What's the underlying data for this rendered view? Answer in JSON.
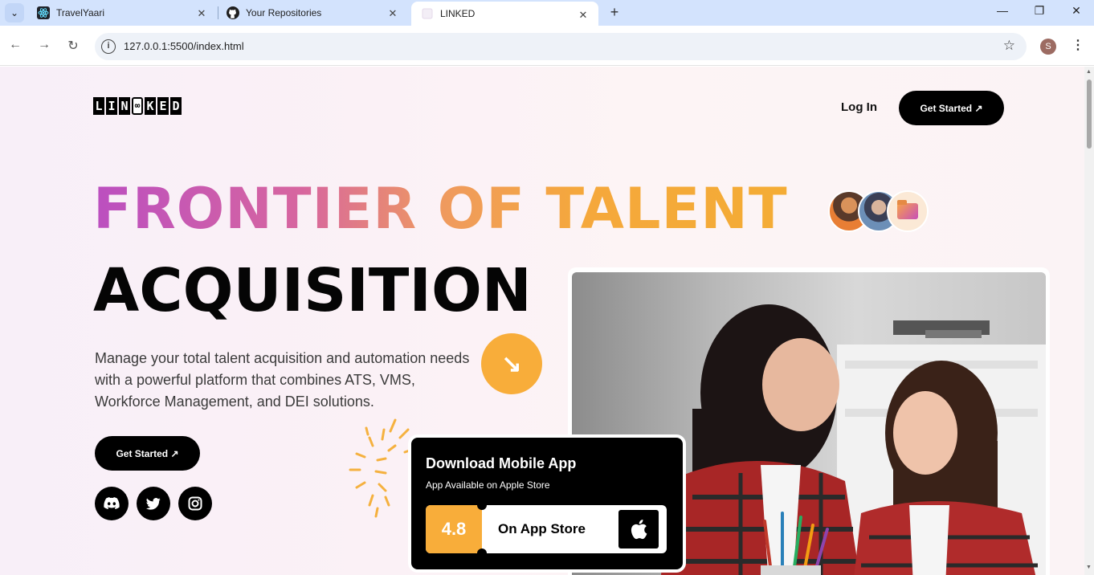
{
  "browser": {
    "tabs": [
      {
        "title": "TravelYaari",
        "icon": "react-icon"
      },
      {
        "title": "Your Repositories",
        "icon": "github-icon"
      },
      {
        "title": "LINKED",
        "icon": "page-icon"
      }
    ],
    "url": "127.0.0.1:5500/index.html",
    "profile_initial": "S"
  },
  "header": {
    "logo_letters": [
      "L",
      "I",
      "N",
      "∞",
      "K",
      "E",
      "D"
    ],
    "login_label": "Log In",
    "cta_label": "Get Started ↗"
  },
  "hero": {
    "headline_line1": "FRONTIER OF TALENT",
    "headline_line2": "ACQUISITION",
    "description": "Manage your total talent acquisition and automation needs with a powerful platform that combines ATS, VMS, Workforce Management, and DEI solutions.",
    "cta_label": "Get Started ↗",
    "arrow_glyph": "↘",
    "social": [
      "discord-icon",
      "twitter-icon",
      "instagram-icon"
    ]
  },
  "app_card": {
    "title": "Download Mobile App",
    "subtitle": "App Available on Apple Store",
    "rating": "4.8",
    "store_label": "On App Store"
  },
  "colors": {
    "accent_orange": "#f8ad3a",
    "gradient_start": "#bb4fc0",
    "gradient_end": "#f4ac35",
    "dark": "#000000"
  }
}
